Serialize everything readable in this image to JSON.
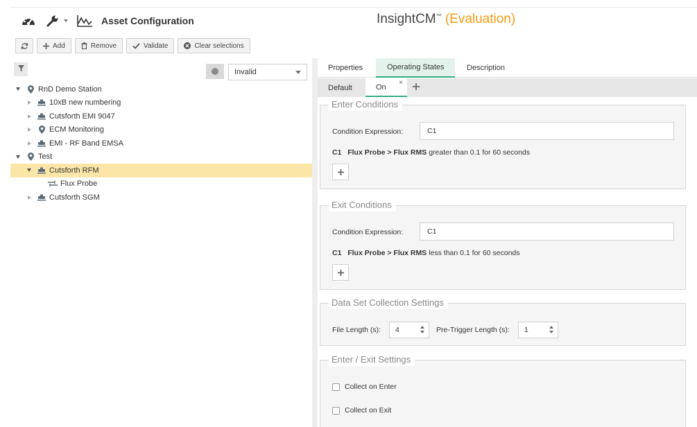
{
  "header": {
    "title": "Asset Configuration",
    "brand": "InsightCM",
    "brand_tm": "™",
    "brand_eval": "(Evaluation)",
    "icons": [
      "dashboard-icon",
      "wrench-icon",
      "chart-icon"
    ]
  },
  "toolbar": {
    "refresh_icon": "refresh-icon",
    "add_label": "Add",
    "remove_label": "Remove",
    "validate_label": "Validate",
    "clear_label": "Clear selections"
  },
  "filter": {
    "status_select": "Invalid"
  },
  "tree": {
    "items": [
      {
        "label": "RnD Demo Station"
      },
      {
        "label": "10xB new numbering"
      },
      {
        "label": "Cutsforth EMI 9047"
      },
      {
        "label": "ECM Monitoring"
      },
      {
        "label": "EMI - RF Band EMSA"
      },
      {
        "label": "Test"
      },
      {
        "label": "Cutsforth RFM"
      },
      {
        "label": "Flux Probe"
      },
      {
        "label": "Cutsforth SGM"
      }
    ]
  },
  "tabs": {
    "properties": "Properties",
    "operating_states": "Operating States",
    "description": "Description"
  },
  "state_tabs": {
    "default": "Default",
    "on": "On",
    "close": "×"
  },
  "enter": {
    "legend": "Enter Conditions",
    "expression_label": "Condition Expression:",
    "expression_value": "C1",
    "cond_id": "C1",
    "cond_path": "Flux Probe > Flux RMS",
    "cond_text": "greater than 0.1 for 60 seconds"
  },
  "exit": {
    "legend": "Exit Conditions",
    "expression_label": "Condition Expression:",
    "expression_value": "C1",
    "cond_id": "C1",
    "cond_path": "Flux Probe > Flux RMS",
    "cond_text": "less than 0.1 for 60 seconds"
  },
  "dataset": {
    "legend": "Data Set Collection Settings",
    "file_length_label": "File Length (s):",
    "file_length_value": "4",
    "pretrigger_label": "Pre-Trigger Length (s):",
    "pretrigger_value": "1"
  },
  "enter_exit": {
    "legend": "Enter / Exit Settings",
    "collect_enter": "Collect on Enter",
    "collect_exit": "Collect on Exit"
  }
}
